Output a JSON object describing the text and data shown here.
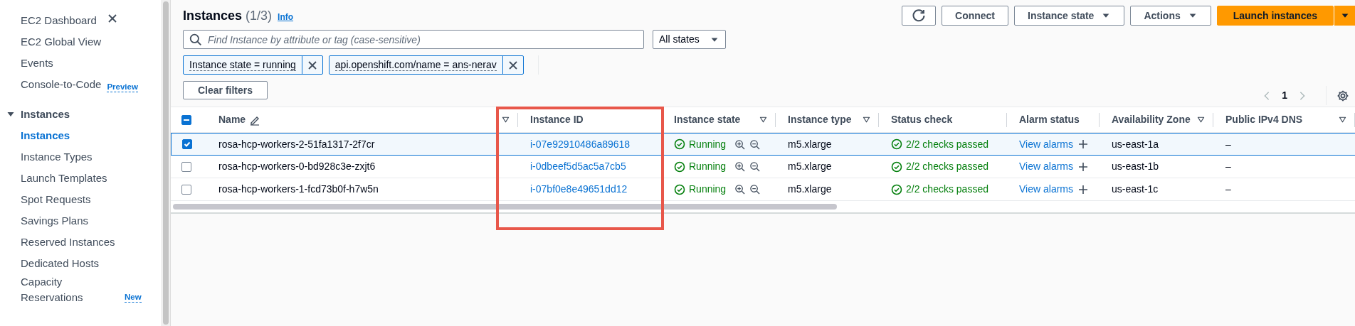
{
  "sidebar": {
    "items": [
      {
        "kind": "link",
        "label": "EC2 Dashboard",
        "selected": false
      },
      {
        "kind": "link",
        "label": "EC2 Global View",
        "selected": false
      },
      {
        "kind": "link",
        "label": "Events",
        "selected": false
      },
      {
        "kind": "link",
        "label": "Console-to-Code",
        "badge": "Preview",
        "selected": false
      },
      {
        "kind": "section",
        "label": "Instances",
        "expanded": true,
        "children": [
          {
            "kind": "link",
            "label": "Instances",
            "selected": true
          },
          {
            "kind": "link",
            "label": "Instance Types",
            "selected": false
          },
          {
            "kind": "link",
            "label": "Launch Templates",
            "selected": false
          },
          {
            "kind": "link",
            "label": "Spot Requests",
            "selected": false
          },
          {
            "kind": "link",
            "label": "Savings Plans",
            "selected": false
          },
          {
            "kind": "link",
            "label": "Reserved Instances",
            "selected": false
          },
          {
            "kind": "link",
            "label": "Dedicated Hosts",
            "selected": false
          },
          {
            "kind": "link",
            "label": "Capacity Reservations",
            "badge": "New",
            "selected": false
          }
        ]
      }
    ]
  },
  "header": {
    "title": "Instances",
    "count": "(1/3)",
    "info": "Info"
  },
  "toolbar": {
    "buttons": [
      {
        "kind": "icon"
      },
      {
        "kind": "plain",
        "label": "Connect"
      },
      {
        "kind": "dropdown",
        "label": "Instance state"
      },
      {
        "kind": "dropdown",
        "label": "Actions"
      },
      {
        "kind": "primary",
        "label": "Launch instances"
      }
    ]
  },
  "search": {
    "placeholder": "Find Instance by attribute or tag (case-sensitive)"
  },
  "state_filter": {
    "value": "All states"
  },
  "filters": [
    {
      "label": "Instance state = running"
    },
    {
      "label": "api.openshift.com/name = ans-nerav"
    }
  ],
  "clear_button": "Clear filters",
  "pagination": {
    "page": "1"
  },
  "table": {
    "header_checkbox": {
      "indeterminate": true
    },
    "columns": [
      {
        "label": "Name",
        "editable": true,
        "filterable": true,
        "highlighted": false
      },
      {
        "label": "Instance ID",
        "editable": false,
        "filterable": false,
        "highlighted": true
      },
      {
        "label": "Instance state",
        "editable": false,
        "filterable": true,
        "highlighted": false
      },
      {
        "label": "Instance type",
        "editable": false,
        "filterable": true,
        "highlighted": false
      },
      {
        "label": "Status check",
        "editable": false,
        "filterable": false,
        "highlighted": false
      },
      {
        "label": "Alarm status",
        "editable": false,
        "filterable": false,
        "highlighted": false
      },
      {
        "label": "Availability Zone",
        "editable": false,
        "filterable": true,
        "highlighted": false
      },
      {
        "label": "Public IPv4 DNS",
        "editable": false,
        "filterable": true,
        "highlighted": false
      }
    ],
    "rows": [
      {
        "selected": true,
        "name": "rosa-hcp-workers-2-51fa1317-2f7cr",
        "instance_id": "i-07e92910486a89618",
        "state": "Running",
        "type": "m5.xlarge",
        "status_check": "2/2 checks passed",
        "alarm": "View alarms",
        "zone": "us-east-1a",
        "dns": "–"
      },
      {
        "selected": false,
        "name": "rosa-hcp-workers-0-bd928c3e-zxjt6",
        "instance_id": "i-0dbeef5d5ac5a7cb5",
        "state": "Running",
        "type": "m5.xlarge",
        "status_check": "2/2 checks passed",
        "alarm": "View alarms",
        "zone": "us-east-1b",
        "dns": "–"
      },
      {
        "selected": false,
        "name": "rosa-hcp-workers-1-fcd73b0f-h7w5n",
        "instance_id": "i-07bf0e8e49651dd12",
        "state": "Running",
        "type": "m5.xlarge",
        "status_check": "2/2 checks passed",
        "alarm": "View alarms",
        "zone": "us-east-1c",
        "dns": "–"
      }
    ]
  }
}
